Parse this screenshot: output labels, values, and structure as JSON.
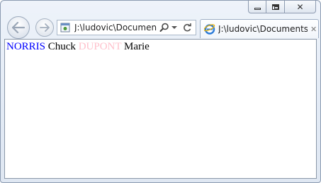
{
  "window": {
    "caption": {
      "minimize_icon": "minimize-icon",
      "maximize_icon": "restore-icon",
      "close_label": "✕"
    }
  },
  "toolbar": {
    "back_icon": "back-arrow-icon",
    "forward_icon": "forward-arrow-icon",
    "address": {
      "value": "J:\\ludovic\\Documents",
      "search_icon": "search-icon",
      "dropdown_icon": "dropdown-icon",
      "refresh_icon": "refresh-icon"
    }
  },
  "tab": {
    "title": "J:\\ludovic\\Documents...",
    "close_label": "✕",
    "icon": "ie-icon"
  },
  "content": {
    "people": [
      {
        "last": "NORRIS",
        "first": "Chuck",
        "last_color": "#0000ff"
      },
      {
        "last": "DUPONT",
        "first": "Marie",
        "last_color": "#ffc0cb"
      }
    ]
  }
}
